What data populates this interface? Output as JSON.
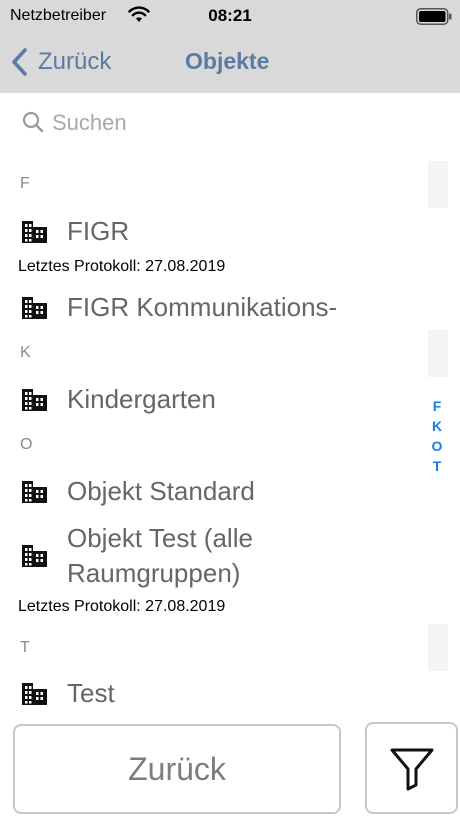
{
  "status_bar": {
    "carrier": "Netzbetreiber",
    "time": "08:21",
    "icons": [
      "wifi-icon",
      "battery-icon"
    ]
  },
  "nav": {
    "back_label": "Zurück",
    "title": "Objekte"
  },
  "search": {
    "placeholder": "Suchen"
  },
  "sections": [
    {
      "letter": "F",
      "items": [
        {
          "title": "FIGR",
          "subtitle": "Letztes Protokoll: 27.08.2019",
          "icon": "building-icon"
        },
        {
          "title": "FIGR Kommunikations-",
          "icon": "building-icon"
        }
      ]
    },
    {
      "letter": "K",
      "items": [
        {
          "title": "Kindergarten",
          "icon": "building-icon"
        }
      ]
    },
    {
      "letter": "O",
      "items": [
        {
          "title": "Objekt Standard",
          "icon": "building-icon"
        },
        {
          "title_line1": "Objekt Test (alle",
          "title_line2": "Raumgruppen)",
          "subtitle": "Letztes Protokoll: 27.08.2019",
          "icon": "building-icon"
        }
      ]
    },
    {
      "letter": "T",
      "items": [
        {
          "title": "Test",
          "icon": "building-icon"
        }
      ]
    }
  ],
  "index": [
    "F",
    "K",
    "O",
    "T"
  ],
  "bottom": {
    "back_button": "Zurück",
    "filter_icon": "filter-icon"
  },
  "colors": {
    "nav_bar": "#d9d9d9",
    "nav_text": "#5b7aa6",
    "index_text": "#1a7fe0",
    "row_text": "#666666"
  }
}
